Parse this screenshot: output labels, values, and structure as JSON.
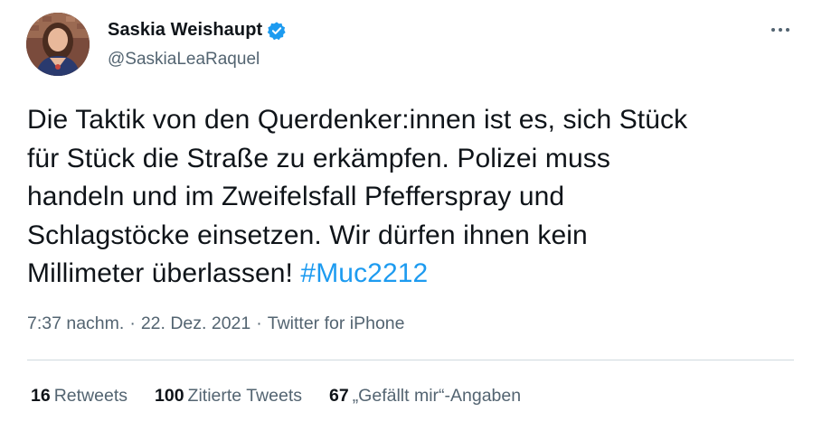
{
  "author": {
    "display_name": "Saskia Weishaupt",
    "handle": "@SaskiaLeaRaquel",
    "verified": true
  },
  "tweet": {
    "lines": [
      "Die Taktik von den Querdenker:innen ist es, sich Stück",
      "für Stück die Straße zu erkämpfen. Polizei muss",
      "handeln und im Zweifelsfall Pfefferspray und",
      "Schlagstöcke einsetzen. Wir dürfen ihnen kein",
      "Millimeter überlassen! "
    ],
    "hashtag": "#Muc2212"
  },
  "meta": {
    "time": "7:37 nachm.",
    "separator": "·",
    "date": "22. Dez. 2021",
    "source": "Twitter for iPhone"
  },
  "stats": {
    "retweets_count": "16",
    "retweets_label": "Retweets",
    "quotes_count": "100",
    "quotes_label": "Zitierte Tweets",
    "likes_count": "67",
    "likes_label": "„Gefällt mir“-Angaben"
  },
  "colors": {
    "text": "#0f1419",
    "secondary": "#536471",
    "accent": "#1d9bf0",
    "divider": "#cfd9de"
  },
  "icons": {
    "verified": "verified-badge-icon",
    "more": "more-options-icon"
  }
}
